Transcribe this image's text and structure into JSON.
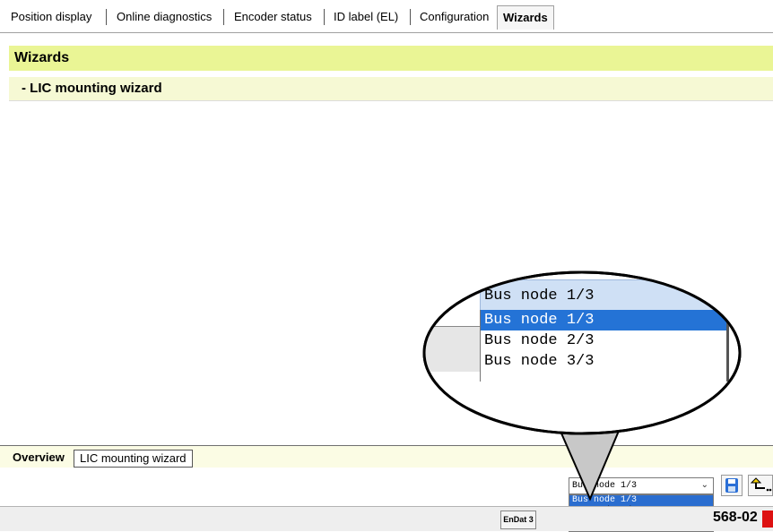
{
  "top_tabs": [
    {
      "label": "Position display"
    },
    {
      "label": "Online diagnostics"
    },
    {
      "label": "Encoder status"
    },
    {
      "label": "ID label (EL)"
    },
    {
      "label": "Configuration"
    },
    {
      "label": "Wizards",
      "active": true
    }
  ],
  "header": {
    "title": "Wizards"
  },
  "subheader": {
    "title": "- LIC mounting wizard"
  },
  "bottom_tabs": [
    {
      "label": "Overview",
      "active": true
    },
    {
      "label": "LIC mounting wizard"
    }
  ],
  "bus_select": {
    "value": "Bus node 1/3",
    "options": [
      "Bus node 1/3",
      "Bus node 2/3",
      "Bus node 3/3"
    ],
    "selected_index": 0
  },
  "status": {
    "endat_label": "EnDat 3",
    "code": "568-02"
  },
  "colors": {
    "header_bg": "#eaf595",
    "subheader_bg": "#f6f9d4",
    "selection": "#2473d6"
  },
  "icons": [
    "save-icon",
    "wizard-arrow-icon",
    "chevron-down-icon",
    "endat-icon",
    "error-icon"
  ]
}
